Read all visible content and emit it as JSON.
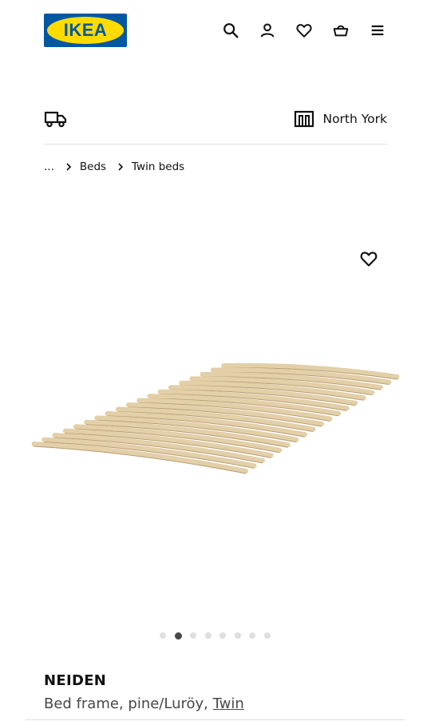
{
  "header": {
    "logo_text": "IKEA",
    "icons": [
      "search-icon",
      "account-icon",
      "heart-icon",
      "basket-icon",
      "menu-icon"
    ]
  },
  "delivery": {
    "icon": "truck-icon",
    "store_icon": "store-icon",
    "store_name": "North York"
  },
  "breadcrumb": {
    "ellipsis": "...",
    "items": [
      "Beds",
      "Twin beds"
    ]
  },
  "gallery": {
    "favorite_icon": "heart-outline-icon",
    "image": "bed-slats-image",
    "total_images": 8,
    "active_index": 1
  },
  "product": {
    "name": "NEIDEN",
    "description": "Bed frame, pine/Luröy,",
    "variant": "Twin"
  },
  "colors": {
    "ikea_blue": "#0058a3",
    "ikea_yellow": "#ffdb00",
    "text": "#111111",
    "muted": "#484848"
  }
}
